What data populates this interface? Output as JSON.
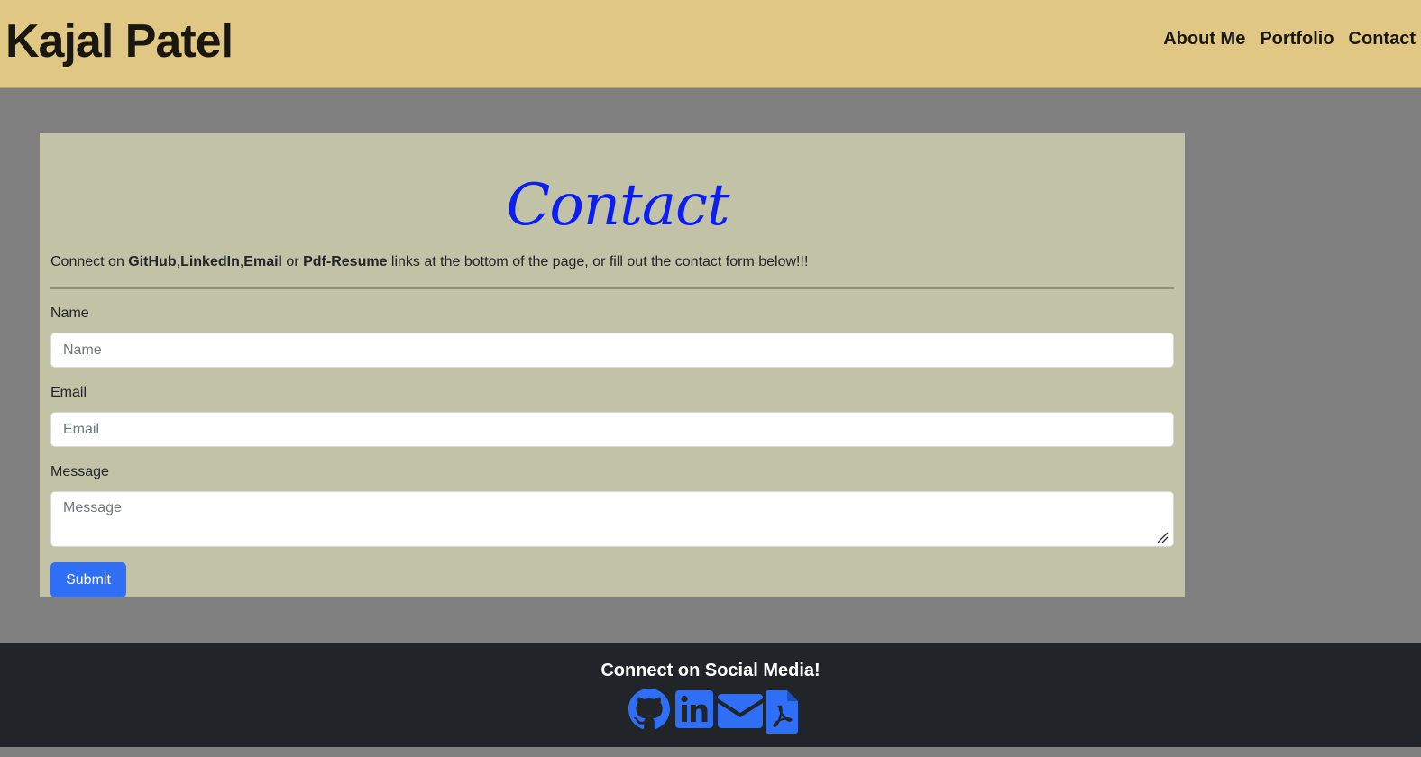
{
  "header": {
    "brand": "Kajal Patel",
    "nav": [
      "About Me",
      "Portfolio",
      "Contact"
    ]
  },
  "contact": {
    "title": "Contact",
    "intro": {
      "prefix": "Connect on ",
      "github": "GitHub",
      "sep1": ",",
      "linkedin": "LinkedIn",
      "sep2": ",",
      "email": "Email",
      "or": " or ",
      "resume": "Pdf-Resume",
      "suffix": " links at the bottom of the page, or fill out the contact form below!!!"
    },
    "form": {
      "name_label": "Name",
      "name_placeholder": "Name",
      "email_label": "Email",
      "email_placeholder": "Email",
      "message_label": "Message",
      "message_placeholder": "Message",
      "submit_label": "Submit"
    }
  },
  "footer": {
    "title": "Connect on Social Media!",
    "icons": [
      "github-icon",
      "linkedin-icon",
      "envelope-icon",
      "pdf-file-icon"
    ],
    "icon_color": "#2f6ff6"
  },
  "colors": {
    "header_bg": "#e1c784",
    "page_bg": "#808080",
    "card_bg": "#c1c2a6",
    "title_color": "#0d1ff0",
    "button_bg": "#2f6ff6",
    "footer_bg": "#212429"
  }
}
